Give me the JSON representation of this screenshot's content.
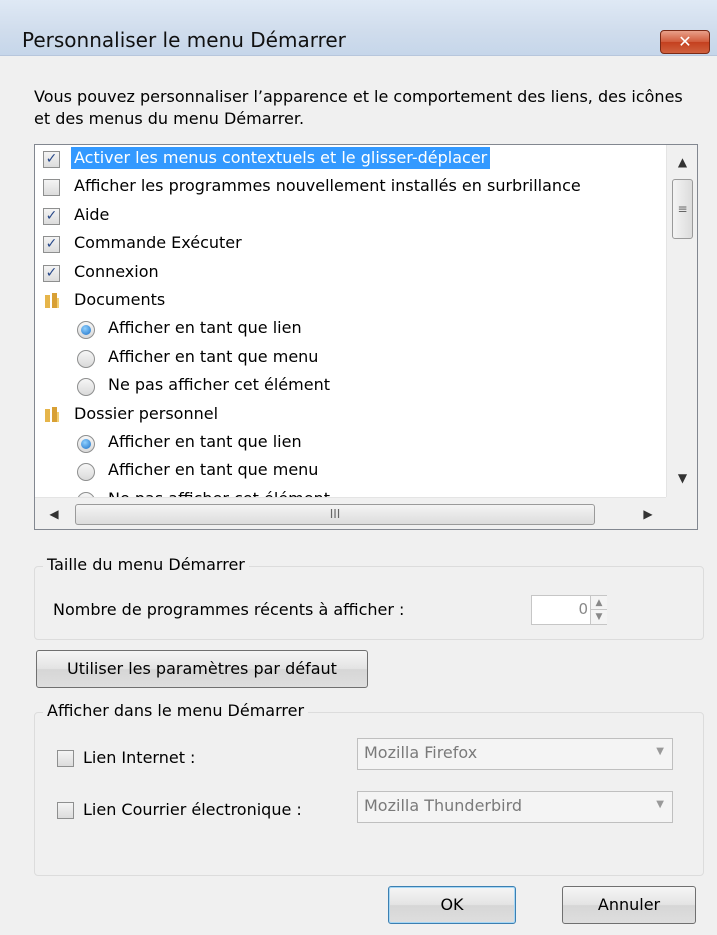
{
  "window": {
    "title": "Personnaliser le menu Démarrer",
    "close_glyph": "✕"
  },
  "description": "Vous pouvez personnaliser l’apparence et le comportement des liens, des icônes et des menus du menu Démarrer.",
  "list": {
    "items": [
      {
        "type": "checkbox",
        "checked": true,
        "label": "Activer les menus contextuels et le glisser-déplacer",
        "selected": true
      },
      {
        "type": "checkbox",
        "checked": false,
        "label": "Afficher les programmes nouvellement installés en surbrillance"
      },
      {
        "type": "checkbox",
        "checked": true,
        "label": "Aide"
      },
      {
        "type": "checkbox",
        "checked": true,
        "label": "Commande Exécuter"
      },
      {
        "type": "checkbox",
        "checked": true,
        "label": "Connexion"
      },
      {
        "type": "folder",
        "label": "Documents"
      },
      {
        "type": "radio",
        "checked": true,
        "label": "Afficher en tant que lien"
      },
      {
        "type": "radio",
        "checked": false,
        "label": "Afficher en tant que menu"
      },
      {
        "type": "radio",
        "checked": false,
        "label": "Ne pas afficher cet élément"
      },
      {
        "type": "folder",
        "label": "Dossier personnel"
      },
      {
        "type": "radio",
        "checked": true,
        "label": "Afficher en tant que lien"
      },
      {
        "type": "radio",
        "checked": false,
        "label": "Afficher en tant que menu"
      },
      {
        "type": "radio",
        "checked": false,
        "label": "Ne pas afficher cet élément"
      }
    ],
    "check_glyph": "✓",
    "scroll_up": "▲",
    "scroll_down": "▼",
    "scroll_left": "◀",
    "scroll_right": "▶",
    "vthumb_grip": "≡",
    "hthumb_grip": "III"
  },
  "size_group": {
    "title": "Taille du menu Démarrer",
    "label": "Nombre de programmes récents à afficher :",
    "value": "0",
    "up": "▲",
    "down": "▼"
  },
  "defaults_button": "Utiliser les paramètres par défaut",
  "show_group": {
    "title": "Afficher dans le menu Démarrer",
    "internet_label": "Lien Internet :",
    "internet_checked": false,
    "internet_value": "Mozilla Firefox",
    "mail_label": "Lien Courrier électronique :",
    "mail_checked": false,
    "mail_value": "Mozilla Thunderbird",
    "chevron": "▼"
  },
  "ok_button": "OK",
  "cancel_button": "Annuler",
  "colors": {
    "selection": "#3399ff",
    "close": "#c4401f"
  }
}
